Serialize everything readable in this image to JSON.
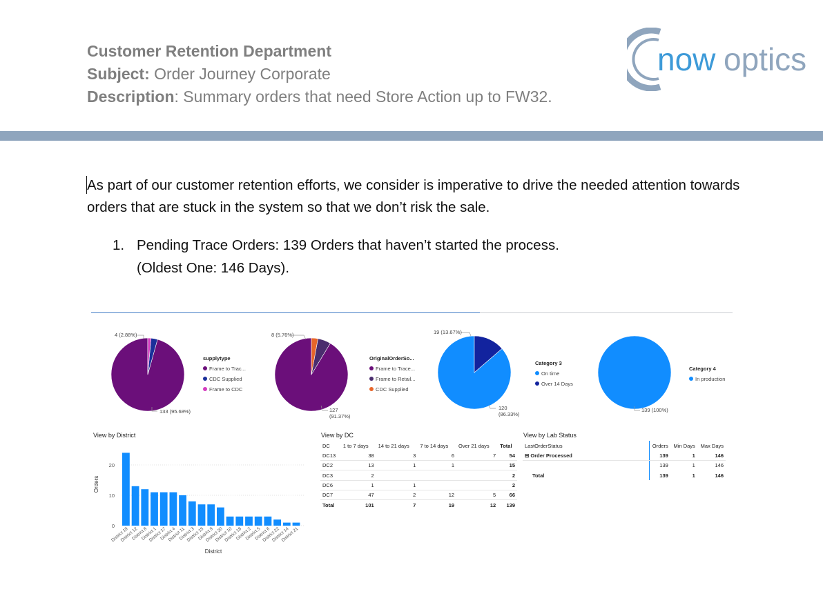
{
  "header": {
    "department": "Customer Retention Department",
    "subject_label": "Subject:",
    "subject_value": "Order Journey Corporate",
    "description_label": "Description",
    "description_value": ": Summary orders that need Store Action up to FW32."
  },
  "logo": {
    "text_now": "now",
    "text_optics": "optics",
    "ring_color": "#8fa5bd",
    "now_color": "#3d9ad8",
    "optics_color": "#8fa5bd"
  },
  "body": {
    "intro": "As part of our customer retention efforts, we consider is imperative to drive the needed attention towards orders that are stuck in the system so that we don’t risk the sale.",
    "list": [
      {
        "number": "1.",
        "line1": "Pending Trace Orders: 139 Orders that haven’t started the process.",
        "line2": "(Oldest One: 146 Days)."
      }
    ]
  },
  "pies": [
    {
      "legend_title": "supplytype",
      "slices": [
        {
          "name": "Frame to Trac...",
          "value": 133,
          "color": "#6b0f7a"
        },
        {
          "name": "CDC Supplied",
          "value": 4,
          "color": "#1a2f9a"
        },
        {
          "name": "Frame to CDC",
          "value": 2,
          "color": "#d43dbf"
        }
      ],
      "label_small": "4 (2.88%)",
      "label_big": "133 (95.68%)"
    },
    {
      "legend_title": "OriginalOrderSo...",
      "slices": [
        {
          "name": "Frame to Trace...",
          "value": 127,
          "color": "#6b0f7a"
        },
        {
          "name": "Frame to Retail...",
          "value": 8,
          "color": "#4a2d6e"
        },
        {
          "name": "CDC Supplied",
          "value": 4,
          "color": "#e8662a"
        }
      ],
      "label_small": "8 (5.76%)",
      "label_big_1": "127",
      "label_big_2": "(91.37%)"
    },
    {
      "legend_title": "Category 3",
      "slices": [
        {
          "name": "On time",
          "value": 120,
          "color": "#118dff"
        },
        {
          "name": "Over 14 Days",
          "value": 19,
          "color": "#12239e"
        }
      ],
      "label_small": "19 (13.67%)",
      "label_big_1": "120",
      "label_big_2": "(86.33%)"
    },
    {
      "legend_title": "Category 4",
      "slices": [
        {
          "name": "In production",
          "value": 139,
          "color": "#118dff"
        }
      ],
      "label_big": "139 (100%)"
    }
  ],
  "district_view": {
    "title": "View by District",
    "ylabel": "Orders",
    "xlabel": "District"
  },
  "chart_data": {
    "type": "bar",
    "categories": [
      "District 19",
      "District 12",
      "District 8",
      "District 1",
      "District 17",
      "District 4",
      "District 11",
      "District 3",
      "District 15",
      "District 9",
      "District 20",
      "District 10",
      "District 18",
      "District 2",
      "District 5",
      "District 6",
      "District 22",
      "District 14",
      "District 21"
    ],
    "values": [
      24,
      13,
      12,
      11,
      11,
      11,
      10,
      8,
      7,
      7,
      6,
      3,
      3,
      3,
      3,
      3,
      2,
      1,
      1
    ],
    "yticks": [
      "0",
      "10",
      "20"
    ],
    "ylim": [
      0,
      25
    ],
    "color": "#118dff"
  },
  "dc_view": {
    "title": "View by DC",
    "headers": [
      "DC",
      "1 to 7 days",
      "14 to 21 days",
      "7 to 14 days",
      "Over 21 days",
      "Total"
    ],
    "rows": [
      [
        "DC13",
        "38",
        "3",
        "6",
        "7",
        "54"
      ],
      [
        "DC2",
        "13",
        "1",
        "1",
        "",
        "15"
      ],
      [
        "DC3",
        "2",
        "",
        "",
        "",
        "2"
      ],
      [
        "DC6",
        "1",
        "1",
        "",
        "",
        "2"
      ],
      [
        "DC7",
        "47",
        "2",
        "12",
        "5",
        "66"
      ]
    ],
    "total": [
      "Total",
      "101",
      "7",
      "19",
      "12",
      "139"
    ]
  },
  "lab_view": {
    "title": "View by Lab Status",
    "headers": [
      "LastOrderStatus",
      "Orders",
      "Min Days",
      "Max Days"
    ],
    "rows": [
      {
        "expand": "⊟",
        "label": "Order Processed",
        "orders": "139",
        "min": "1",
        "max": "146"
      },
      {
        "expand": "",
        "label": "",
        "orders": "139",
        "min": "1",
        "max": "146"
      }
    ],
    "total": {
      "label": "Total",
      "orders": "139",
      "min": "1",
      "max": "146"
    }
  }
}
